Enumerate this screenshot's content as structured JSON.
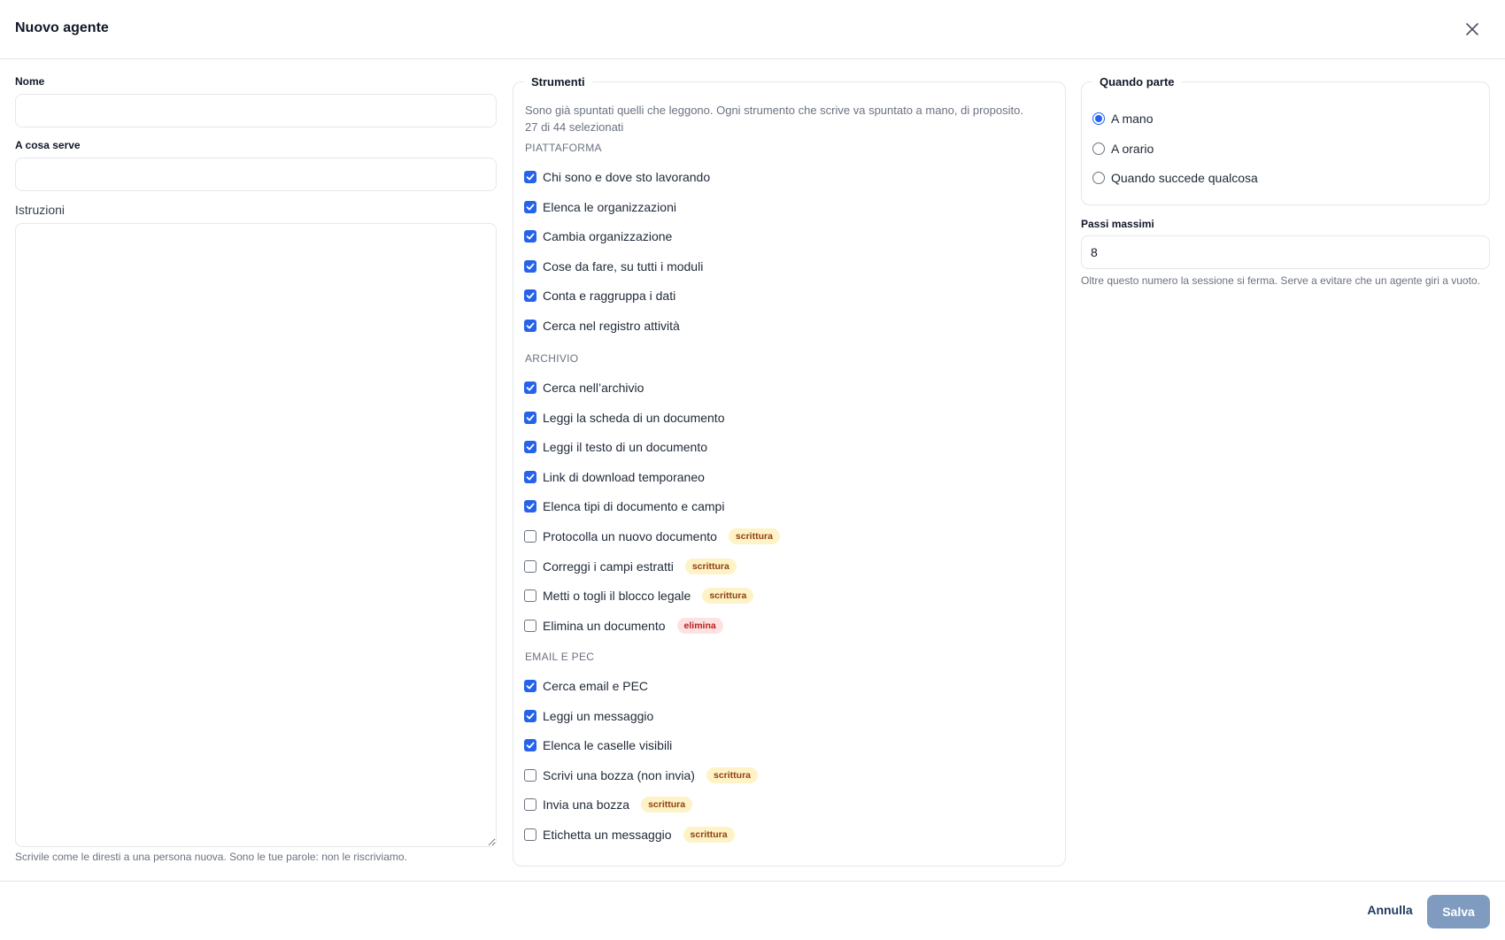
{
  "dialog": {
    "title": "Nuovo agente"
  },
  "form": {
    "name_label": "Nome",
    "name_value": "",
    "purpose_label": "A cosa serve",
    "purpose_value": "",
    "instructions_label": "Istruzioni",
    "instructions_value": "",
    "instructions_help": "Scrivile come le diresti a una persona nuova. Sono le tue parole: non le riscriviamo."
  },
  "tools": {
    "legend": "Strumenti",
    "intro": "Sono già spuntati quelli che leggono. Ogni strumento che scrive va spuntato a mano, di proposito.",
    "count": "27 di 44 selezionati",
    "groups": [
      {
        "title": "PIATTAFORMA",
        "items": [
          {
            "label": "Chi sono e dove sto lavorando",
            "checked": true
          },
          {
            "label": "Elenca le organizzazioni",
            "checked": true
          },
          {
            "label": "Cambia organizzazione",
            "checked": true
          },
          {
            "label": "Cose da fare, su tutti i moduli",
            "checked": true
          },
          {
            "label": "Conta e raggruppa i dati",
            "checked": true
          },
          {
            "label": "Cerca nel registro attività",
            "checked": true
          }
        ]
      },
      {
        "title": "ARCHIVIO",
        "items": [
          {
            "label": "Cerca nell’archivio",
            "checked": true
          },
          {
            "label": "Leggi la scheda di un documento",
            "checked": true
          },
          {
            "label": "Leggi il testo di un documento",
            "checked": true
          },
          {
            "label": "Link di download temporaneo",
            "checked": true
          },
          {
            "label": "Elenca tipi di documento e campi",
            "checked": true
          },
          {
            "label": "Protocolla un nuovo documento",
            "checked": false,
            "badge": "scrittura"
          },
          {
            "label": "Correggi i campi estratti",
            "checked": false,
            "badge": "scrittura"
          },
          {
            "label": "Metti o togli il blocco legale",
            "checked": false,
            "badge": "scrittura"
          },
          {
            "label": "Elimina un documento",
            "checked": false,
            "badge": "elimina"
          }
        ]
      },
      {
        "title": "EMAIL E PEC",
        "items": [
          {
            "label": "Cerca email e PEC",
            "checked": true
          },
          {
            "label": "Leggi un messaggio",
            "checked": true
          },
          {
            "label": "Elenca le caselle visibili",
            "checked": true
          },
          {
            "label": "Scrivi una bozza (non invia)",
            "checked": false,
            "badge": "scrittura"
          },
          {
            "label": "Invia una bozza",
            "checked": false,
            "badge": "scrittura"
          },
          {
            "label": "Etichetta un messaggio",
            "checked": false,
            "badge": "scrittura"
          }
        ]
      }
    ]
  },
  "trigger": {
    "legend": "Quando parte",
    "options": [
      {
        "label": "A mano",
        "selected": true
      },
      {
        "label": "A orario",
        "selected": false
      },
      {
        "label": "Quando succede qualcosa",
        "selected": false
      }
    ]
  },
  "max_steps": {
    "label": "Passi massimi",
    "value": "8",
    "help": "Oltre questo numero la sessione si ferma. Serve a evitare che un agente giri a vuoto."
  },
  "footer": {
    "cancel_label": "Annulla",
    "save_label": "Salva"
  }
}
